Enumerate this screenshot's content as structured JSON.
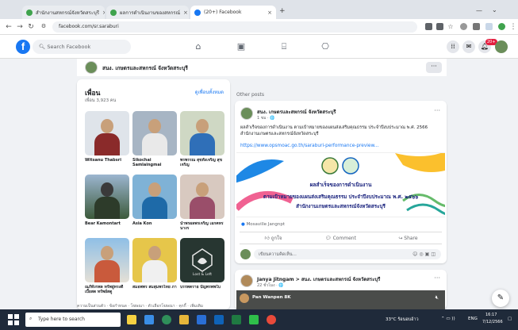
{
  "browser": {
    "tabs": [
      {
        "label": "สำนักงานสหกรณ์จังหวัดสระบุรี",
        "active": false
      },
      {
        "label": "ผลการดำเนินงานของสหกรณ์",
        "active": false
      },
      {
        "label": "(20+) Facebook",
        "active": true
      }
    ],
    "new_tab": "+",
    "url": "facebook.com/sr.saraburi"
  },
  "facebook": {
    "logo": "f",
    "search_placeholder": "Search Facebook",
    "notifications_badge": "20+",
    "page_name": "สนง. เกษตรและสหกรณ์ จังหวัดสระบุรี",
    "more": "···"
  },
  "friends": {
    "title": "เพื่อน",
    "count": "เพื่อน 3,923 คน",
    "see_all": "ดูเพื่อนทั้งหมด",
    "items": [
      {
        "name": "Witsanu Thabsri"
      },
      {
        "name": "Sikochai Samlaingmai"
      },
      {
        "name": "พรพรรณ สุขทั้งเจริญ สุขเจริญ"
      },
      {
        "name": "Bear Kamontart"
      },
      {
        "name": "Asia Kon"
      },
      {
        "name": "นำพรผลพรเจริญ เอกคทรนางร"
      },
      {
        "name": "ณภัทั่งรพล ทรัพยู่ทรงดี เบี้ยสด ทรัพย์สดู"
      },
      {
        "name": "สมอพพร สมสุมพรไทย ภา"
      },
      {
        "name": "บรรพตราย บัญพรพพใบ"
      }
    ],
    "third_tile_text": "Lost & Left",
    "footer": "ความเป็นส่วนตัว · ข้อกำหนด · โฆษณา · ตัวเลือกโฆษณา · คุกกี้ · เพิ่มเติม"
  },
  "feed": {
    "other_posts": "Other posts",
    "post1": {
      "author": "สนง. เกษตรและสหกรณ์ จังหวัดสระบุรี",
      "meta": "1 ชม · 🌐",
      "text": "ผลสำเร็จของการดำเนินงาน ตามเป้าหมายของแผนส่งเสริมคุณธรรม ประจำปีงบประมาณ พ.ศ. 2566 สำนักงานเกษตรและสหกรณ์จังหวัดสระบุรี",
      "link": "https://www.opsmoac.go.th/saraburi-performance-preview...",
      "banner_line1": "ผลสำเร็จของการดำเนินงาน",
      "banner_line2": "ตามเป้าหมายของแผนส่งเสริมคุณธรรม ประจำปีงบประมาณ พ.ศ. ๒๕๖๖",
      "banner_line3": "สำนักงานเกษตรและสหกรณ์จังหวัดสระบุรี",
      "reactions": "Mosaville Jangnpt",
      "like": "ถูกใจ",
      "comment": "Comment",
      "share": "Share",
      "comment_placeholder": "เขียนความคิดเห็น..."
    },
    "post2": {
      "author": "Janya Jitngam > สนง. เกษตรและสหกรณ์ จังหวัดสระบุรี",
      "meta": "22 ชั่วโมง · 🌐",
      "video_label": "Pan Wanpen 8K"
    }
  },
  "taskbar": {
    "search_placeholder": "Type here to search",
    "weather": "33°C ร้อนอบอ้าว",
    "lang": "ENG",
    "time": "16:17",
    "date": "7/12/2566"
  },
  "colors": {
    "fb_blue": "#1877f2",
    "taskbar": "#1f2a3a"
  }
}
